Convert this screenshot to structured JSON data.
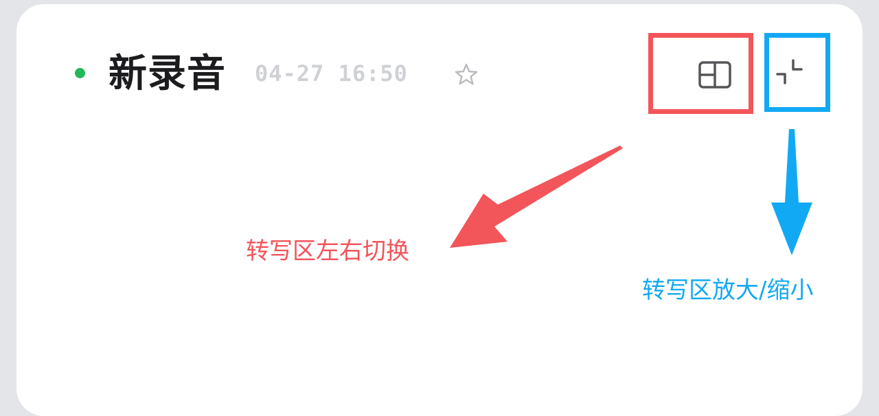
{
  "header": {
    "title": "新录音",
    "timestamp": "04-27 16:50",
    "status_color": "#22b85a"
  },
  "toolbar": {
    "favorite_icon": "star-outline-icon",
    "split_toggle_icon": "layout-split-icon",
    "minimize_icon": "collapse-icon"
  },
  "annotations": {
    "split_toggle_label": "转写区左右切换",
    "resize_label": "转写区放大/缩小",
    "red_color": "#f2555a",
    "blue_color": "#12a9f4"
  }
}
